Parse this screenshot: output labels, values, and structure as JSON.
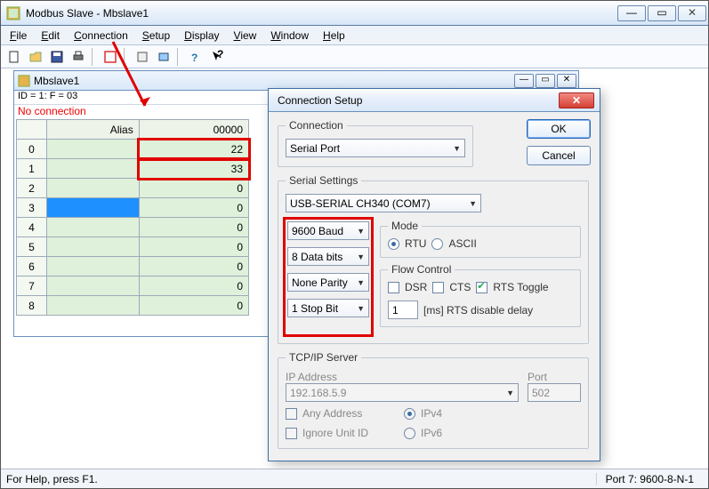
{
  "window": {
    "title": "Modbus Slave - Mbslave1"
  },
  "menubar": [
    "File",
    "Edit",
    "Connection",
    "Setup",
    "Display",
    "View",
    "Window",
    "Help"
  ],
  "child": {
    "title": "Mbslave1",
    "info": "ID = 1: F = 03",
    "noconn": "No connection",
    "headers": {
      "alias": "Alias",
      "col0": "00000"
    },
    "rows": [
      {
        "i": "0",
        "alias": "",
        "v": "22"
      },
      {
        "i": "1",
        "alias": "",
        "v": "33"
      },
      {
        "i": "2",
        "alias": "",
        "v": "0"
      },
      {
        "i": "3",
        "alias": "",
        "v": "0"
      },
      {
        "i": "4",
        "alias": "",
        "v": "0"
      },
      {
        "i": "5",
        "alias": "",
        "v": "0"
      },
      {
        "i": "6",
        "alias": "",
        "v": "0"
      },
      {
        "i": "7",
        "alias": "",
        "v": "0"
      },
      {
        "i": "8",
        "alias": "",
        "v": "0"
      }
    ]
  },
  "dialog": {
    "title": "Connection Setup",
    "ok": "OK",
    "cancel": "Cancel",
    "conn_group": "Connection",
    "conn_value": "Serial Port",
    "serial_group": "Serial Settings",
    "serial_port": "USB-SERIAL CH340 (COM7)",
    "baud": "9600 Baud",
    "databits": "8 Data bits",
    "parity": "None Parity",
    "stopbits": "1 Stop Bit",
    "mode_group": "Mode",
    "mode_rtu": "RTU",
    "mode_ascii": "ASCII",
    "flow_group": "Flow Control",
    "flow_dsr": "DSR",
    "flow_cts": "CTS",
    "flow_rts": "RTS Toggle",
    "rts_delay": "1",
    "rts_delay_lbl": "[ms] RTS disable delay",
    "tcp_group": "TCP/IP Server",
    "ip_label": "IP Address",
    "ip_value": "192.168.5.9",
    "port_label": "Port",
    "port_value": "502",
    "any_addr": "Any Address",
    "ignore_uid": "Ignore Unit ID",
    "ipv4": "IPv4",
    "ipv6": "IPv6"
  },
  "status": {
    "left": "For Help, press F1.",
    "right": "Port 7: 9600-8-N-1"
  }
}
